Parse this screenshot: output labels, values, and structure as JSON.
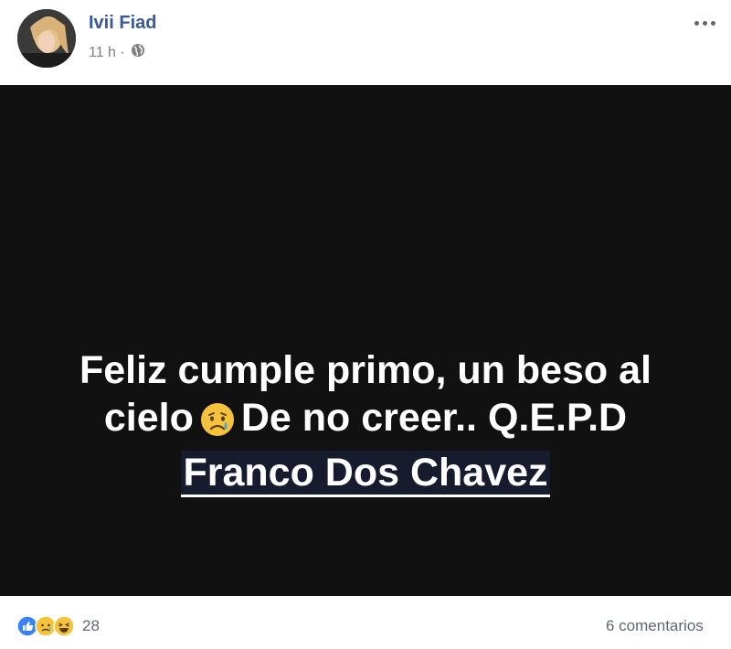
{
  "post": {
    "author": "Ivii Fiad",
    "time": "11 h ·",
    "privacy_icon": "globe-icon",
    "text_line1": "Feliz cumple primo, un beso al",
    "text_line2_a": "cielo",
    "text_line2_b": "De no creer.. Q.E.P.D",
    "mention": "Franco Dos Chavez",
    "background_color": "#111111",
    "author_color": "#385898"
  },
  "footer": {
    "reaction_icons": [
      "like-icon",
      "sad-icon",
      "haha-icon"
    ],
    "reaction_count": "28",
    "comments": "6 comentarios"
  }
}
